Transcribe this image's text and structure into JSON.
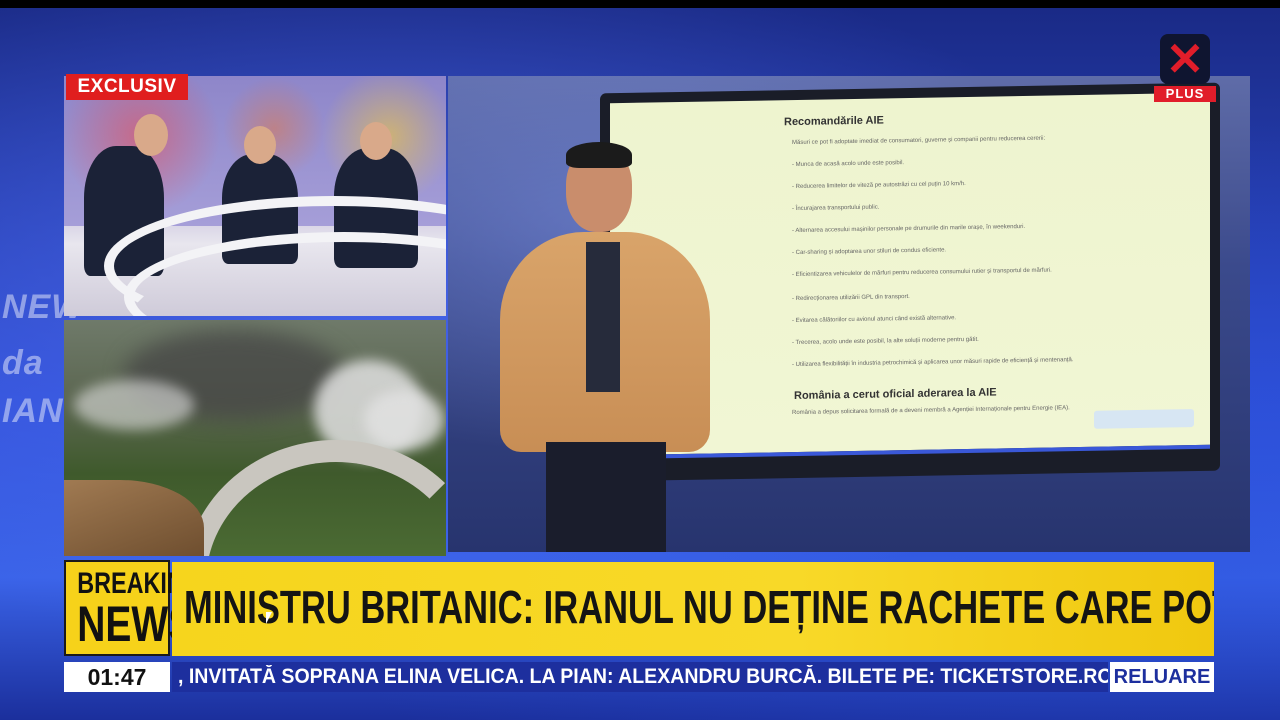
{
  "overlay": {
    "exclusive_tag": "EXCLUSIV",
    "channel_logo": {
      "icon": "x-logo-icon",
      "sub_label": "PLUS",
      "brand_color": "#e11d2a"
    }
  },
  "screen_document": {
    "section_title": "Recomandările AIE",
    "bullets": [
      "Măsuri ce pot fi adoptate imediat de consumatori, guverne și companii pentru reducerea cererii:",
      "- Munca de acasă acolo unde este posibil.",
      "- Reducerea limitelor de viteză pe autostrăzi cu cel puțin 10 km/h.",
      "- Încurajarea transportului public.",
      "- Alternarea accesului mașinilor personale pe drumurile din marile orașe, în weekenduri.",
      "- Car-sharing și adoptarea unor stiluri de condus eficiente.",
      "- Eficientizarea vehiculelor de mărfuri pentru reducerea consumului rutier și transportul de mărfuri.",
      "- Redirecționarea utilizării GPL din transport.",
      "- Evitarea călătoriilor cu avionul atunci când există alternative.",
      "- Trecerea, acolo unde este posibil, la alte soluții moderne pentru gătit.",
      "- Utilizarea flexibilității în industria petrochimică și aplicarea unor măsuri rapide de eficiență și mentenanță."
    ],
    "section_heading": "România a cerut oficial aderarea la AIE",
    "footnote": "România a depus solicitarea formală de a deveni membră a Agenției Internaționale pentru Energie (IEA)."
  },
  "ticker": {
    "breaking_line1": "BREAKING",
    "breaking_line2": "NEWS",
    "headline": "MINISTRU BRITANIC: IRANUL NU DEȚINE RACHETE CARE POT VIZA EUROPA",
    "time": "01:47",
    "crawl": ", INVITATĂ SOPRANA ELINA VELICA. LA PIAN: ALEXANDRU BURCĂ. BILETE PE: TICKETSTORE.RO",
    "replay_label": "RELUARE",
    "colors": {
      "headline_bg": "#f6d51d",
      "crawl_bg": "#1d2f9e"
    }
  },
  "background": {
    "wall_letters": [
      "NEW",
      "da",
      "IAN"
    ]
  }
}
